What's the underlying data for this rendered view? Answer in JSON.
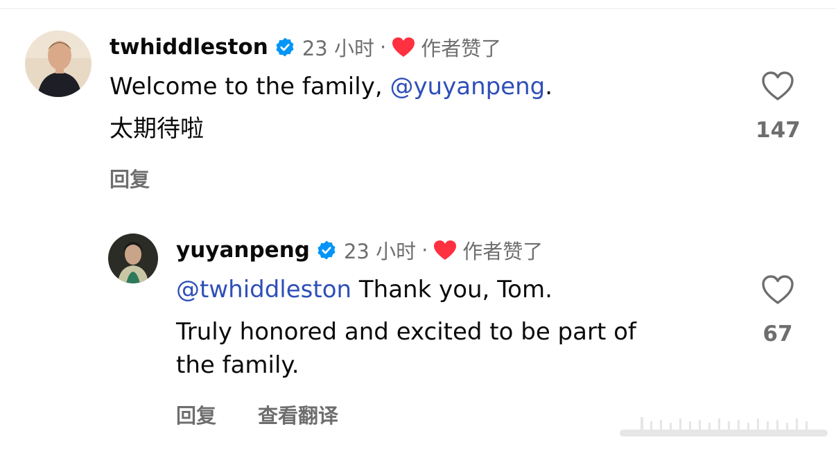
{
  "comments": [
    {
      "username": "twhiddleston",
      "time": "23 小时",
      "separator": "·",
      "liked_by_author": "作者赞了",
      "body_line1_text": "Welcome to the family, ",
      "body_line1_mention": "@yuyanpeng",
      "body_line1_suffix": ".",
      "body_line2": "太期待啦",
      "reply_label": "回复",
      "like_count": "147"
    },
    {
      "username": "yuyanpeng",
      "time": "23 小时",
      "separator": "·",
      "liked_by_author": "作者赞了",
      "body_line1_mention": "@twhiddleston",
      "body_line1_text": " Thank you, Tom.",
      "body_line2": "Truly honored and excited to be part of",
      "body_line3": "the family.",
      "reply_label": "回复",
      "translate_label": "查看翻译",
      "like_count": "67"
    }
  ],
  "icons": {
    "verified": "verified-badge-icon",
    "author_heart": "red-heart-icon",
    "like": "heart-outline-icon"
  },
  "colors": {
    "verified_blue": "#0095f6",
    "heart_red": "#ff3040",
    "mention": "#2e4fb8",
    "secondary": "#6e6e6e"
  }
}
